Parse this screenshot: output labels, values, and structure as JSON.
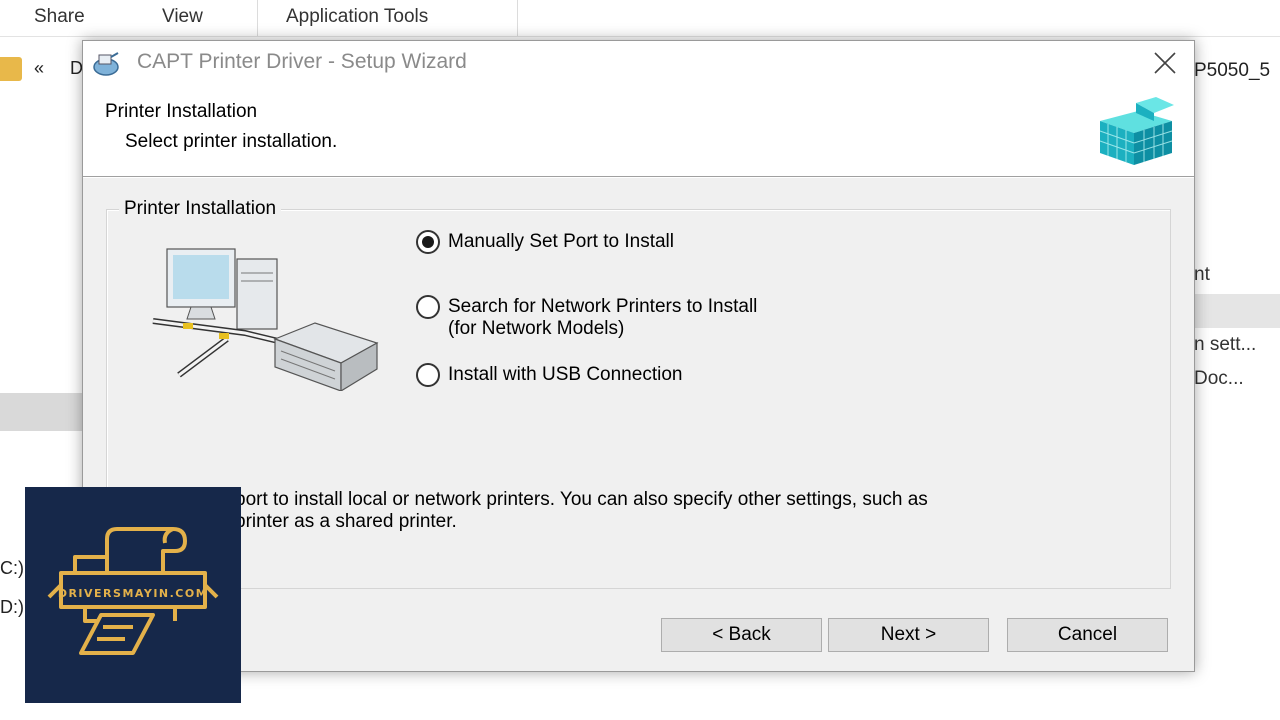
{
  "background_window": {
    "ribbon_tabs": [
      "Share",
      "View",
      "Application Tools"
    ],
    "address_prefix": "«",
    "address_partial": "D",
    "address_right_partial": "P5050_5",
    "right_pane_items": [
      "nt",
      "n sett...",
      "Doc..."
    ],
    "drives": [
      "C:)",
      "D:)"
    ]
  },
  "dialog": {
    "title": "CAPT Printer Driver - Setup Wizard",
    "close_icon": "close-icon",
    "header_title": "Printer Installation",
    "header_subtitle": "Select printer installation.",
    "group_label": "Printer Installation",
    "options": [
      {
        "line1": "Manually Set Port to Install",
        "line2": "",
        "checked": true
      },
      {
        "line1": "Search for Network Printers to Install",
        "line2": "(for Network Models)",
        "checked": false
      },
      {
        "line1": "Install with USB Connection",
        "line2": "",
        "checked": false
      }
    ],
    "description_line1": "port to install local or network printers. You can also specify other settings, such as",
    "description_line2": "printer as a shared printer.",
    "buttons": {
      "back": "< Back",
      "next": "Next >",
      "cancel": "Cancel"
    }
  },
  "watermark": {
    "text": "DRIVERSMAYIN.COM",
    "bg_color": "#16284a",
    "accent_color": "#e3b14a"
  }
}
